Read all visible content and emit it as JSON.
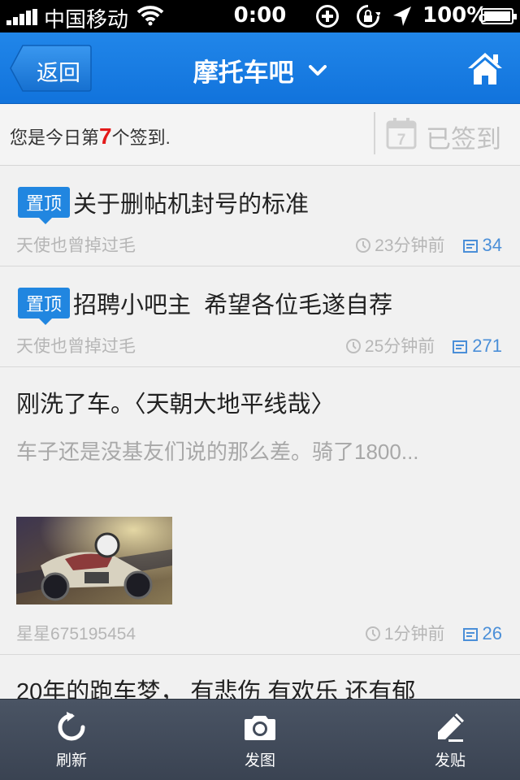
{
  "status_bar": {
    "carrier": "中国移动",
    "time": "0:00",
    "battery": "100%"
  },
  "nav": {
    "back_label": "返回",
    "title": "摩托车吧"
  },
  "signin": {
    "prefix": "您是今日第",
    "rank": "7",
    "suffix": "个签到.",
    "status": "已签到",
    "calendar_day": "7"
  },
  "posts": [
    {
      "pinned": true,
      "badge": "置顶",
      "title": "关于删帖机封号的标准",
      "author": "天使也曾掉过毛",
      "time": "23分钟前",
      "replies": "34"
    },
    {
      "pinned": true,
      "badge": "置顶",
      "title": "招聘小吧主  希望各位毛遂自荐",
      "author": "天使也曾掉过毛",
      "time": "25分钟前",
      "replies": "271"
    },
    {
      "pinned": false,
      "title": "刚洗了车。〈天朝大地平线哉〉",
      "excerpt": "车子还是没基友们说的那么差。骑了1800...",
      "has_image": true,
      "author": "星星675195454",
      "time": "1分钟前",
      "replies": "26"
    },
    {
      "pinned": false,
      "title": "20年的跑车梦， 有悲伤  有欢乐  还有郁"
    }
  ],
  "toolbar": {
    "refresh_label": "刷新",
    "photo_label": "发图",
    "post_label": "发贴"
  },
  "colors": {
    "nav_blue": "#1a7ee6",
    "pin_blue": "#2186e0",
    "rank_red": "#e31a1a",
    "toolbar": "#434c5b"
  }
}
